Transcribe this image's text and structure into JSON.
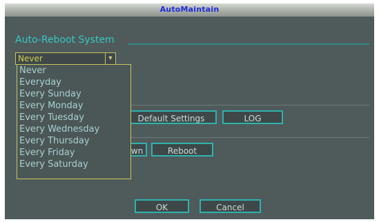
{
  "window": {
    "title": "AutoMaintain"
  },
  "section": {
    "title": "Auto-Reboot System"
  },
  "reboot_select": {
    "value": "Never",
    "options": [
      "Never",
      "Everyday",
      "Every Sunday",
      "Every Monday",
      "Every Tuesday",
      "Every Wednesday",
      "Every Thursday",
      "Every Friday",
      "Every Saturday"
    ]
  },
  "buttons": {
    "default_settings": "Default Settings",
    "log": "LOG",
    "shutdown_partial": "wn",
    "reboot": "Reboot",
    "ok": "OK",
    "cancel": "Cancel"
  },
  "colors": {
    "background": "#4f5a5b",
    "accent": "#35c9c4",
    "title_text": "#1f2fd8",
    "select_border": "#c8c65a"
  }
}
